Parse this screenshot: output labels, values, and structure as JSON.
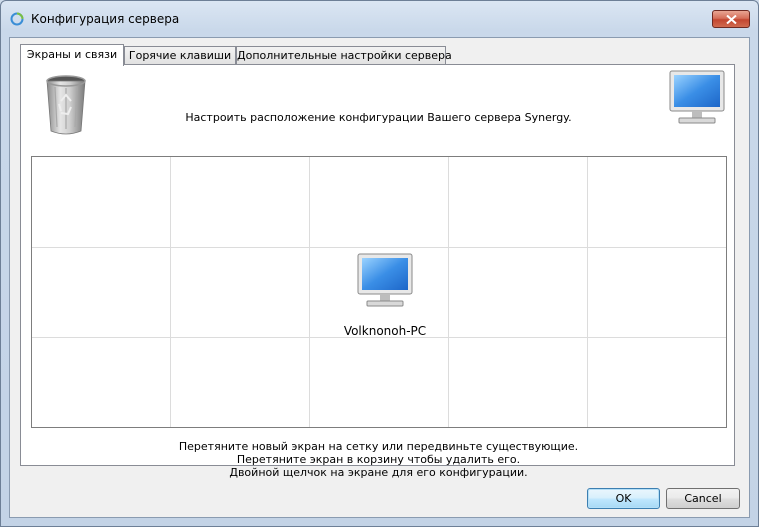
{
  "window": {
    "title": "Конфигурация сервера"
  },
  "tabs": [
    {
      "label": "Экраны и связи",
      "active": true
    },
    {
      "label": "Горячие клавиши",
      "active": false
    },
    {
      "label": "Дополнительные настройки сервера",
      "active": false
    }
  ],
  "panel": {
    "instruction": "Настроить расположение конфигурации Вашего сервера Synergy.",
    "grid": {
      "columns": 5,
      "rows": 3
    },
    "screen": {
      "name": "Volknonoh-PC",
      "column": 3,
      "row": 2
    },
    "hints": [
      "Перетяните новый экран на сетку или передвиньте существующие.",
      "Перетяните экран в корзину чтобы удалить его.",
      "Двойной щелчок на экране для его конфигурации."
    ]
  },
  "buttons": {
    "ok": "OK",
    "cancel": "Cancel"
  },
  "icons": {
    "app": "synergy-app-icon",
    "trash": "trash-icon",
    "new_screen": "monitor-icon"
  },
  "colors": {
    "title_bar": "#c9d8ea",
    "close_button": "#c34630",
    "default_button_border": "#3c7fb1"
  }
}
